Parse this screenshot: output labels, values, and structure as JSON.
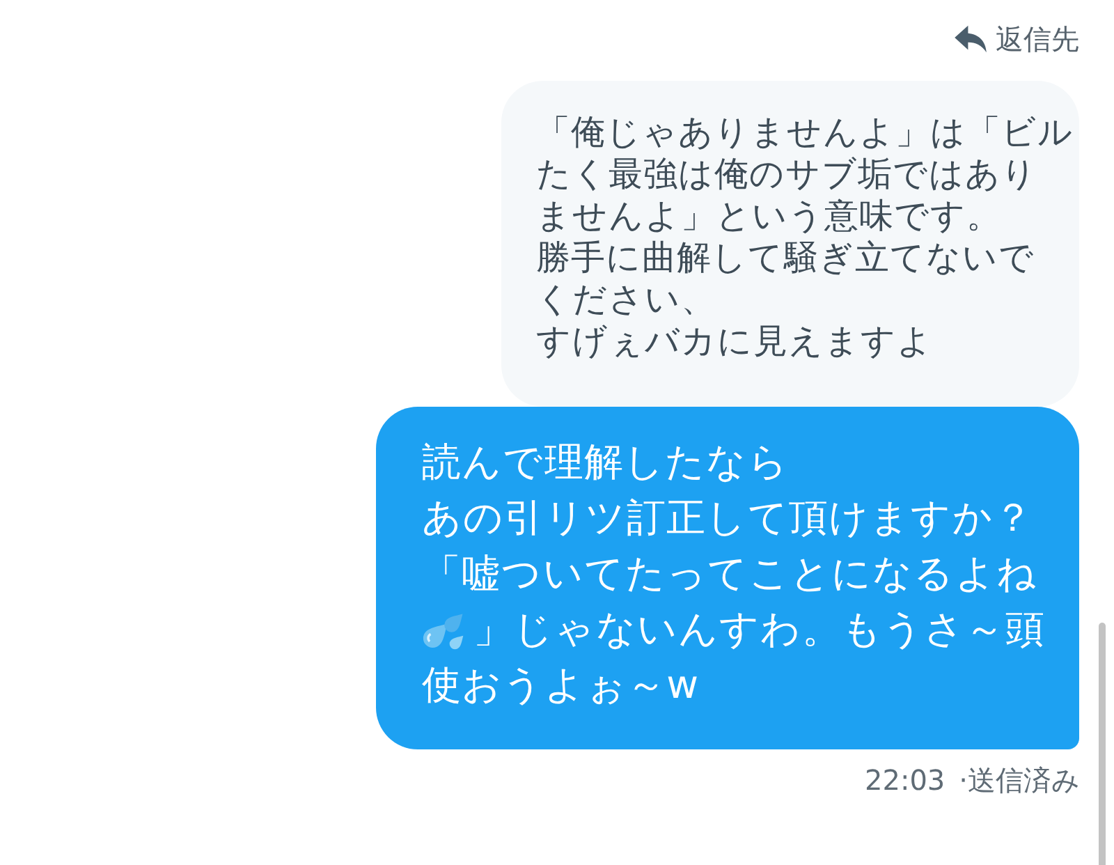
{
  "header": {
    "reply_label": "返信先"
  },
  "messages": [
    {
      "kind": "received",
      "parts": [
        {
          "kind": "text",
          "text": "「俺じゃありませんよ」は「ビル"
        },
        {
          "kind": "text",
          "text": "たく最強は俺のサブ垢ではあり"
        },
        {
          "kind": "text",
          "text": "ませんよ」という意味です。"
        },
        {
          "kind": "text",
          "text": "勝手に曲解して騒ぎ立てないで"
        },
        {
          "kind": "text",
          "text": "ください、"
        },
        {
          "kind": "text",
          "text": "すげぇバカに見えますよ"
        }
      ]
    },
    {
      "kind": "sent",
      "parts": [
        {
          "kind": "text",
          "text": "読んで理解したなら"
        },
        {
          "kind": "text",
          "text": "あの引リツ訂正して頂けますか？"
        },
        {
          "kind": "text",
          "text": "「嘘ついてたってことになるよね"
        },
        {
          "kind": "emoji"
        },
        {
          "kind": "text",
          "text": "」じゃないんすわ。もうさ～頭"
        },
        {
          "kind": "text",
          "text": "使おうよぉ～w"
        }
      ],
      "time": "22:03",
      "status": "·送信済み"
    }
  ]
}
